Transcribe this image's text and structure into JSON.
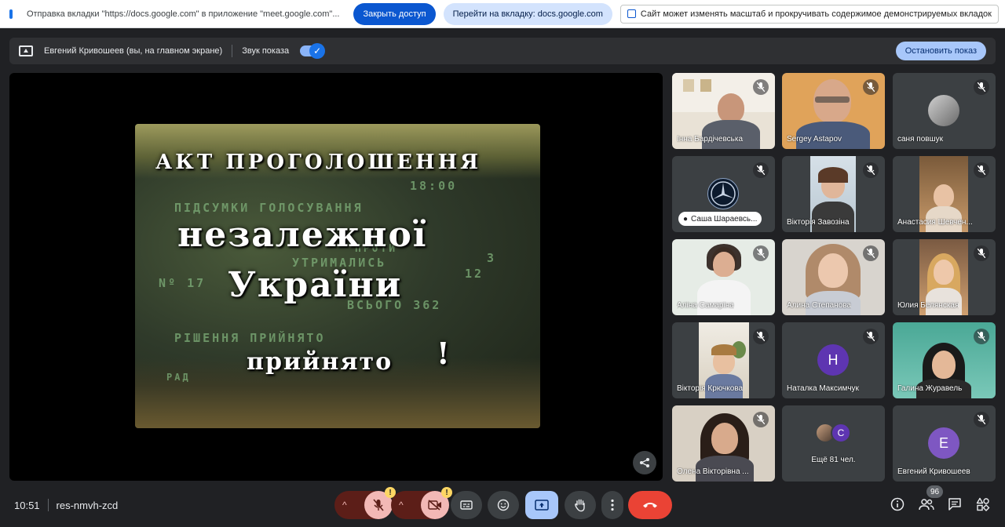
{
  "sharebar": {
    "message": "Отправка вкладки \"https://docs.google.com\" в приложение \"meet.google.com\"...",
    "stop_access": "Закрыть доступ",
    "go_to_tab": "Перейти на вкладку: docs.google.com",
    "scroll_notice": "Сайт может изменять масштаб и прокручивать содержимое демонстрируемых вкладок"
  },
  "presentbar": {
    "presenter": "Евгений Кривошеев (вы, на главном экране)",
    "audio_label": "Звук показа",
    "audio_enabled": true,
    "stop_button": "Остановить показ"
  },
  "slide": {
    "line1": "АКТ ПРОГОЛОШЕННЯ",
    "line2": "незалежної",
    "line3": "України",
    "line4": "прийнято",
    "bang": "!",
    "screen_time": "18:00",
    "screen_l1": "ПІДСУМКИ ГОЛОСУВАННЯ",
    "screen_l2": "ПРОТИ",
    "screen_l3": "УТРИМАЛИСЬ",
    "screen_n3": "3",
    "screen_n12": "12",
    "screen_l4": "Nº 17",
    "screen_l5": "ВСЬОГО 362",
    "screen_l6": "РІШЕННЯ ПРИЙНЯТО",
    "screen_l7": "РАД"
  },
  "participants": [
    {
      "name": "Інна Бардічевська"
    },
    {
      "name": "Sergey Astapov"
    },
    {
      "name": "саня повшук"
    },
    {
      "name": "Саша Шараевсь..."
    },
    {
      "name": "Вікторія Завозіна"
    },
    {
      "name": "Анастасия Шевчен..."
    },
    {
      "name": "Аліна Самаріна"
    },
    {
      "name": "Алина Степанова"
    },
    {
      "name": "Юлия Белянская"
    },
    {
      "name": "Вікторія Крючкова"
    },
    {
      "name": "Наталка Максимчук",
      "initial": "Н"
    },
    {
      "name": "Галина Журавель"
    },
    {
      "name": "Олена Вікторівна ..."
    },
    {
      "name": "Ещё 81 чел.",
      "initial": "C"
    },
    {
      "name": "Евгений Кривошеев",
      "initial": "Е"
    }
  ],
  "bottombar": {
    "time": "10:51",
    "meeting_code": "res-nmvh-zcd",
    "people_count": "96",
    "mic_warning": "!",
    "cam_warning": "!"
  },
  "colors": {
    "accent": "#1a73e8",
    "leave": "#ea4335",
    "avatar_purple": "#5e35b1",
    "avatar_violet": "#7e57c2"
  }
}
